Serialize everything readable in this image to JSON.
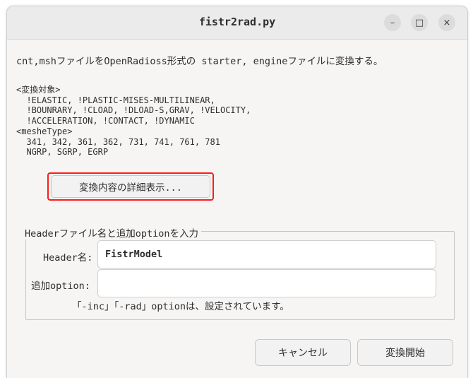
{
  "window": {
    "title": "fistr2rad.py"
  },
  "titlebar": {
    "minimize_icon": "–",
    "maximize_icon": "□",
    "close_icon": "×"
  },
  "main": {
    "description": "cnt,mshファイルをOpenRadioss形式の starter, engineファイルに変換する。",
    "info_lines": [
      "<変換対象>",
      "  !ELASTIC, !PLASTIC-MISES-MULTILINEAR,",
      "  !BOUNRARY, !CLOAD, !DLOAD-S,GRAV, !VELOCITY,",
      "  !ACCELERATION, !CONTACT, !DYNAMIC",
      "<mesheType>",
      "  341, 342, 361, 362, 731, 741, 761, 781",
      "  NGRP, SGRP, EGRP"
    ],
    "detail_button": "変換内容の詳細表示..."
  },
  "group": {
    "legend": "Headerファイル名と追加optionを入力",
    "header_label": "Header名:",
    "header_value": "FistrModel",
    "option_label": "追加option:",
    "option_value": "",
    "hint": "「-inc」「-rad」optionは、設定されています。"
  },
  "buttons": {
    "cancel": "キャンセル",
    "start": "変換開始"
  },
  "colors": {
    "highlight": "#ff1a1a",
    "window_bg": "#f6f5f4",
    "titlebar_bg": "#ebebeb"
  }
}
